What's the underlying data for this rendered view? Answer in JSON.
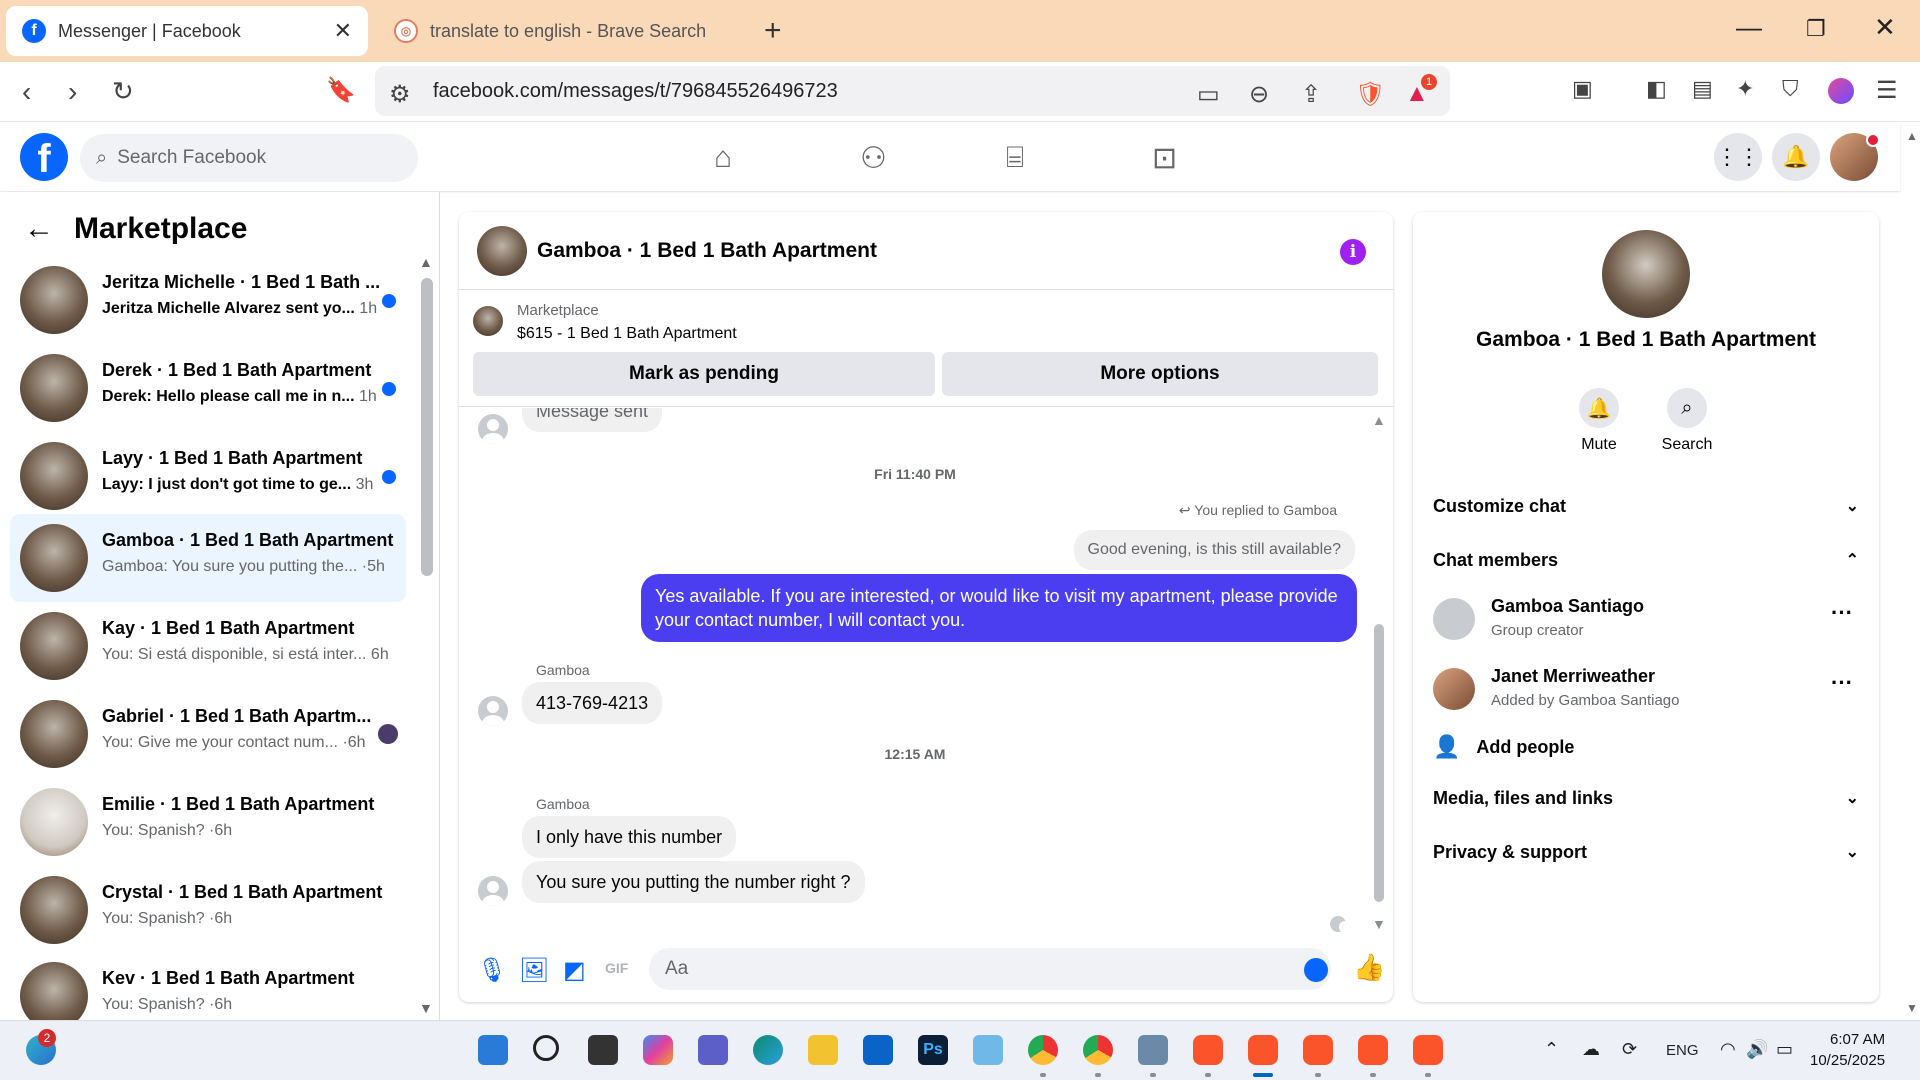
{
  "browser": {
    "tabs": [
      {
        "title": "Messenger | Facebook",
        "favicon": "facebook-icon",
        "active": true
      },
      {
        "title": "translate to english - Brave Search",
        "favicon": "brave-search-icon",
        "active": false
      }
    ],
    "url": "facebook.com/messages/t/796845526496723",
    "notification_badge": "1"
  },
  "fb_header": {
    "logo_letter": "f",
    "search_placeholder": "Search Facebook"
  },
  "sidebar": {
    "title": "Marketplace",
    "conversations": [
      {
        "name": "Jeritza Michelle · 1 Bed 1 Bath ...",
        "preview": "Jeritza Michelle Alvarez sent yo...",
        "time": "1h",
        "unread": true
      },
      {
        "name": "Derek · 1 Bed 1 Bath Apartment",
        "preview": "Derek: Hello please call me in n...",
        "time": "1h",
        "unread": true
      },
      {
        "name": "Layy · 1 Bed 1 Bath Apartment",
        "preview": "Layy: I just don't got time to ge...",
        "time": "3h",
        "unread": true
      },
      {
        "name": "Gamboa · 1 Bed 1 Bath Apartment",
        "preview": "Gamboa: You sure you putting the... ·",
        "time": "5h",
        "unread": false,
        "selected": true
      },
      {
        "name": "Kay · 1 Bed 1 Bath Apartment",
        "preview": "You: Si está disponible, si está inter...",
        "time": "6h",
        "unread": false
      },
      {
        "name": "Gabriel · 1 Bed 1 Bath Apartm...",
        "preview": "You: Give me your contact num... ·",
        "time": "6h",
        "unread": false
      },
      {
        "name": "Emilie · 1 Bed 1 Bath Apartment",
        "preview": "You: Spanish? ·",
        "time": "6h",
        "unread": false
      },
      {
        "name": "Crystal · 1 Bed 1 Bath Apartment",
        "preview": "You: Spanish? ·",
        "time": "6h",
        "unread": false
      },
      {
        "name": "Kev · 1 Bed 1 Bath Apartment",
        "preview": "You: Spanish? ·",
        "time": "6h",
        "unread": false
      }
    ]
  },
  "chat": {
    "title": "Gamboa · 1 Bed 1 Bath Apartment",
    "marketplace_label": "Marketplace",
    "listing": "$615 - 1 Bed 1 Bath Apartment",
    "btn_pending": "Mark as pending",
    "btn_more": "More options",
    "partial_bubble": "Message sent",
    "ts1": "Fri 11:40 PM",
    "reply_note": "You replied to Gamboa",
    "quoted": "Good evening, is this still available?",
    "outgoing": "Yes available. If you are interested, or would like to visit my apartment, please provide your contact number, I will contact you.",
    "sender1": "Gamboa",
    "msg_phone": "413-769-4213",
    "ts2": "12:15 AM",
    "sender2": "Gamboa",
    "msg_only": "I only have this number",
    "msg_sure": "You sure you putting the number right ?",
    "composer_placeholder": "Aa",
    "accent": "#4a3ef0"
  },
  "panel": {
    "title": "Gamboa · 1 Bed 1 Bath Apartment",
    "mute": "Mute",
    "search": "Search",
    "customize": "Customize chat",
    "members_header": "Chat members",
    "members": [
      {
        "name": "Gamboa Santiago",
        "sub": "Group creator"
      },
      {
        "name": "Janet Merriweather",
        "sub": "Added by Gamboa Santiago"
      }
    ],
    "add_people": "Add people",
    "media": "Media, files and links",
    "privacy": "Privacy & support"
  },
  "taskbar": {
    "widget_badge": "2",
    "lang": "ENG",
    "time": "6:07 AM",
    "date": "10/25/2025"
  }
}
